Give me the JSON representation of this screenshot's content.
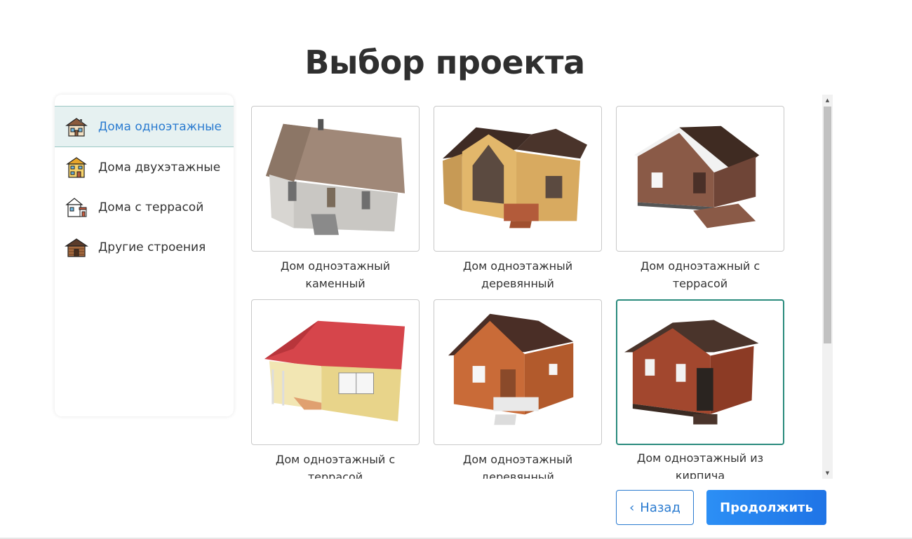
{
  "page": {
    "title": "Выбор проекта"
  },
  "sidebar": {
    "items": [
      {
        "label": "Дома одноэтажные",
        "icon": "one-story-house-icon",
        "active": true
      },
      {
        "label": "Дома двухэтажные",
        "icon": "two-story-house-icon",
        "active": false
      },
      {
        "label": "Дома с террасой",
        "icon": "house-with-terrace-icon",
        "active": false
      },
      {
        "label": "Другие строения",
        "icon": "other-building-icon",
        "active": false
      }
    ]
  },
  "projects": [
    {
      "line1": "Дом одноэтажный",
      "line2": "каменный",
      "image": "stone-house-image"
    },
    {
      "line1": "Дом одноэтажный",
      "line2": "деревянный",
      "image": "wooden-house-image"
    },
    {
      "line1": "Дом одноэтажный с",
      "line2": "террасой",
      "image": "terrace-house-image"
    },
    {
      "line1": "Дом одноэтажный с",
      "line2": "террасой",
      "image": "red-roof-terrace-house-image"
    },
    {
      "line1": "Дом одноэтажный",
      "line2": "деревянный",
      "image": "orange-wooden-house-image"
    },
    {
      "line1": "Дом одноэтажный из",
      "line2": "кирпича",
      "image": "brick-house-image",
      "selected": true
    }
  ],
  "buttons": {
    "back": "Назад",
    "next": "Продолжить"
  },
  "colors": {
    "accent": "#2a7bd0",
    "selected_border": "#2a8b7d",
    "active_bg": "#e6f1f1"
  }
}
